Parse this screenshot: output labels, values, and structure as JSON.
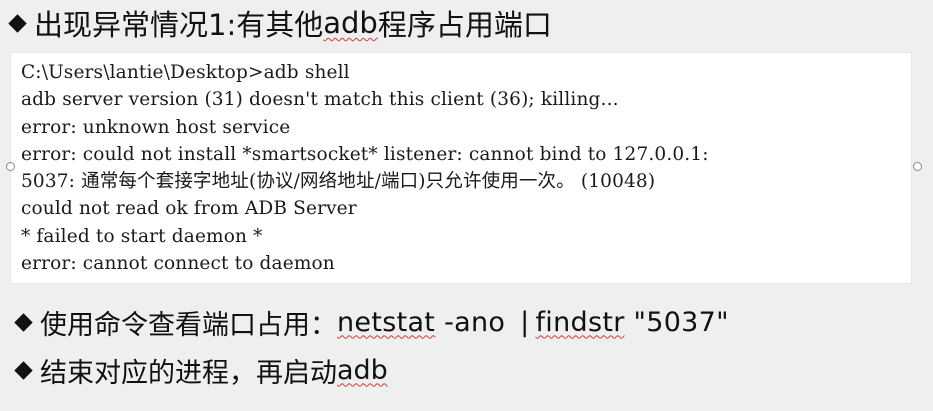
{
  "heading": {
    "prefix": "出现异常情况1:有其他",
    "adb": "adb",
    "suffix": "程序占用端口"
  },
  "terminal": {
    "lines": [
      "C:\\Users\\lantie\\Desktop>adb shell",
      "adb server version (31) doesn't match this client (36); killing...",
      "error: unknown host service",
      "error: could not install *smartsocket* listener: cannot bind to 127.0.0.1:",
      "5037: 通常每个套接字地址(协议/网络地址/端口)只允许使用一次。 (10048)",
      "could not read ok from ADB Server",
      "* failed to start daemon *",
      "error: cannot connect to daemon"
    ]
  },
  "bullet2": {
    "label": "使用命令查看端口占用：",
    "cmd1": "netstat",
    "cmd2": " -ano ",
    "pipe": "|",
    "cmd3": "findstr",
    "cmd4": " \"5037\""
  },
  "bullet3": {
    "text": "结束对应的进程，再启动",
    "adb": "adb"
  },
  "icons": {
    "bullet": "diamond-bullet-icon",
    "handle": "selection-handle-icon"
  }
}
